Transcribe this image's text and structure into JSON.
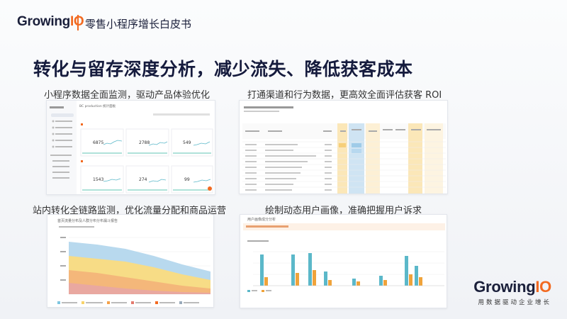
{
  "header": {
    "logo_main": "Growing",
    "logo_accent": "IO",
    "doc_title": "零售小程序增长白皮书"
  },
  "main_title": "转化与留存深度分析，减少流失、降低获客成本",
  "sections": [
    {
      "caption": "小程序数据全面监测，驱动产品体验优化"
    },
    {
      "caption": "打通渠道和行为数据，更高效全面评估获客 ROI"
    },
    {
      "caption": "站内转化全链路监测，优化流量分配和商品运营"
    },
    {
      "caption": "绘制动态用户画像，准确把握用户诉求"
    }
  ],
  "screenshot_1": {
    "title": "BC production 统计面板",
    "kpis": [
      "6875",
      "2788",
      "549",
      "1543",
      "274",
      "99"
    ]
  },
  "screenshot_3": {
    "title": "首页流量分布及人群分布分布漏斗报告"
  },
  "screenshot_4": {
    "title": "用户画像成分分析"
  },
  "footer": {
    "logo_main": "Growing",
    "logo_accent": "IO",
    "tagline": "用数据驱动企业增长"
  },
  "colors": {
    "brand_orange": "#f26a21",
    "brand_navy": "#151b3d",
    "chart_teal": "#5bb8c9",
    "chart_orange": "#f0a33a",
    "chart_yellow": "#f5d77a",
    "chart_blue": "#a9cde6"
  }
}
